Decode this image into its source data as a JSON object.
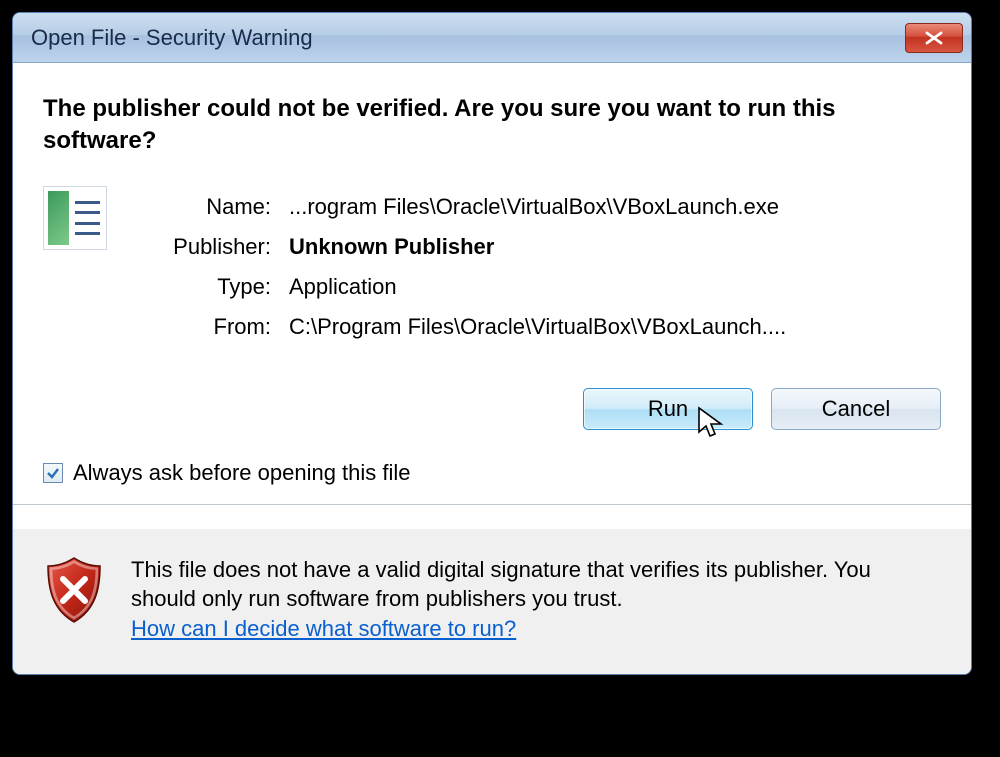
{
  "window": {
    "title": "Open File - Security Warning"
  },
  "headline": "The publisher could not be verified.  Are you sure you want to run this software?",
  "fields": {
    "name_label": "Name:",
    "name_value": "...rogram Files\\Oracle\\VirtualBox\\VBoxLaunch.exe",
    "publisher_label": "Publisher:",
    "publisher_value": "Unknown Publisher",
    "type_label": "Type:",
    "type_value": "Application",
    "from_label": "From:",
    "from_value": "C:\\Program Files\\Oracle\\VirtualBox\\VBoxLaunch...."
  },
  "buttons": {
    "run": "Run",
    "cancel": "Cancel"
  },
  "checkbox": {
    "label": "Always ask before opening this file",
    "checked": true
  },
  "footer": {
    "text": "This file does not have a valid digital signature that verifies its publisher.  You should only run software from publishers you trust.",
    "link": "How can I decide what software to run?"
  }
}
